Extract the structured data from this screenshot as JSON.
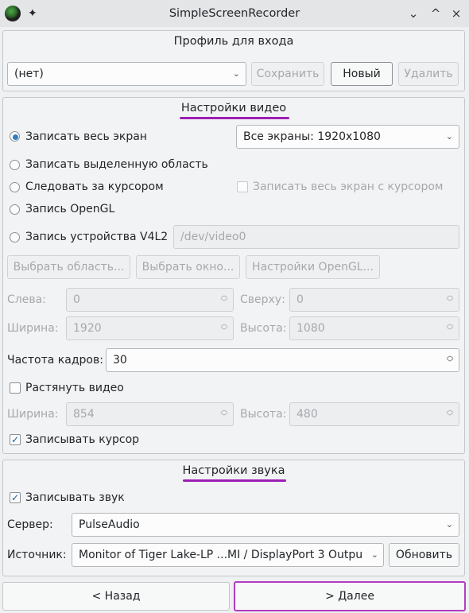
{
  "window": {
    "title": "SimpleScreenRecorder",
    "controls": [
      "⌄",
      "^",
      "×"
    ]
  },
  "profile": {
    "title": "Профиль для входа",
    "selected": "(нет)",
    "save": "Сохранить",
    "new": "Новый",
    "delete": "Удалить"
  },
  "video": {
    "title": "Настройки видео",
    "record_fullscreen": "Записать весь экран",
    "screens_select": "Все экраны: 1920x1080",
    "record_region": "Записать выделенную область",
    "follow_cursor": "Следовать за курсором",
    "fullscreen_with_cursor": "Записать весь экран с курсором",
    "record_opengl": "Запись OpenGL",
    "record_v4l2": "Запись устройства V4L2",
    "v4l2_device": "/dev/video0",
    "select_rect": "Выбрать область...",
    "select_window": "Выбрать окно...",
    "opengl_settings": "Настройки OpenGL...",
    "left_label": "Слева:",
    "left_value": "0",
    "top_label": "Сверху:",
    "top_value": "0",
    "width_label": "Ширина:",
    "width_value": "1920",
    "height_label": "Высота:",
    "height_value": "1080",
    "framerate_label": "Частота кадров:",
    "framerate_value": "30",
    "scale_video": "Растянуть видео",
    "scaled_width_label": "Ширина:",
    "scaled_width_value": "854",
    "scaled_height_label": "Высота:",
    "scaled_height_value": "480",
    "record_cursor": "Записывать курсор"
  },
  "audio": {
    "title": "Настройки звука",
    "record_audio": "Записывать звук",
    "backend_label": "Сервер:",
    "backend_value": "PulseAudio",
    "source_label": "Источник:",
    "source_value": "Monitor of Tiger Lake-LP ...MI / DisplayPort 3 Outpu",
    "refresh": "Обновить"
  },
  "nav": {
    "back": "< Назад",
    "next": "> Далее"
  },
  "icons": {
    "pin": "✦",
    "check": "✓",
    "dropdown": "⌄",
    "spin_up": "︿",
    "spin_down": "﹀"
  },
  "colors": {
    "accent": "#9b1fb5",
    "radio_fill": "#2e7fc9"
  }
}
